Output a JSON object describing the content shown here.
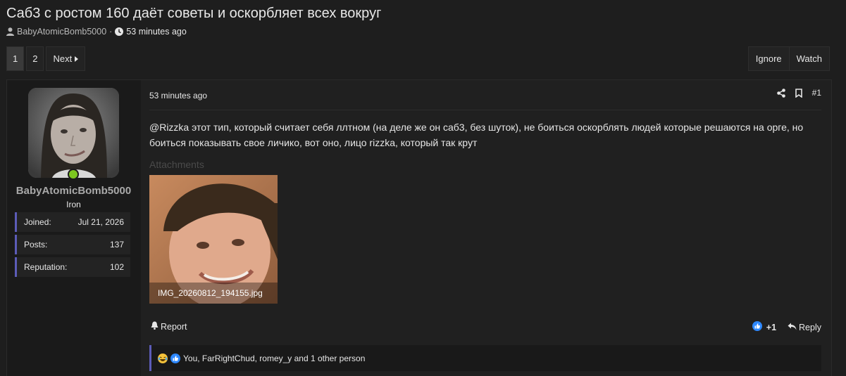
{
  "thread": {
    "title": "Саб3 с ростом 160 даёт советы и оскорбляет всех вокруг",
    "author": "BabyAtomicBomb5000",
    "separator": "·",
    "time": "53 minutes ago"
  },
  "pagination": {
    "pages": [
      "1",
      "2"
    ],
    "current": "1",
    "next_label": "Next"
  },
  "thread_actions": {
    "ignore_label": "Ignore",
    "watch_label": "Watch"
  },
  "post": {
    "user": {
      "name": "BabyAtomicBomb5000",
      "rank": "Iron",
      "online": true,
      "stats": [
        {
          "label": "Joined:",
          "value": "Jul 21, 2026"
        },
        {
          "label": "Posts:",
          "value": "137"
        },
        {
          "label": "Reputation:",
          "value": "102"
        }
      ]
    },
    "time": "53 minutes ago",
    "number": "#1",
    "body": "@Rizzka этот тип, который считает себя ллтном (на деле же он саб3, без шуток), не боиться оскорблять людей которые решаются на орге, но боиться показывать свое личико, вот оно, лицо rizzka, который так крут",
    "attachments_label": "Attachments",
    "attachment": {
      "filename": "IMG_20260812_194155.jpg"
    },
    "report_label": "Report",
    "reaction_score": "+1",
    "reply_label": "Reply",
    "reactions_text": "You, FarRightChud, romey_y and 1 other person"
  },
  "colors": {
    "online": "#7cc620",
    "accent_border": "#5c5cb8",
    "like_blue": "#2d88ff"
  },
  "icons": [
    "user-icon",
    "clock-icon",
    "caret-right-icon",
    "share-icon",
    "bookmark-icon",
    "bell-icon",
    "like-icon",
    "reply-icon",
    "laugh-icon"
  ]
}
